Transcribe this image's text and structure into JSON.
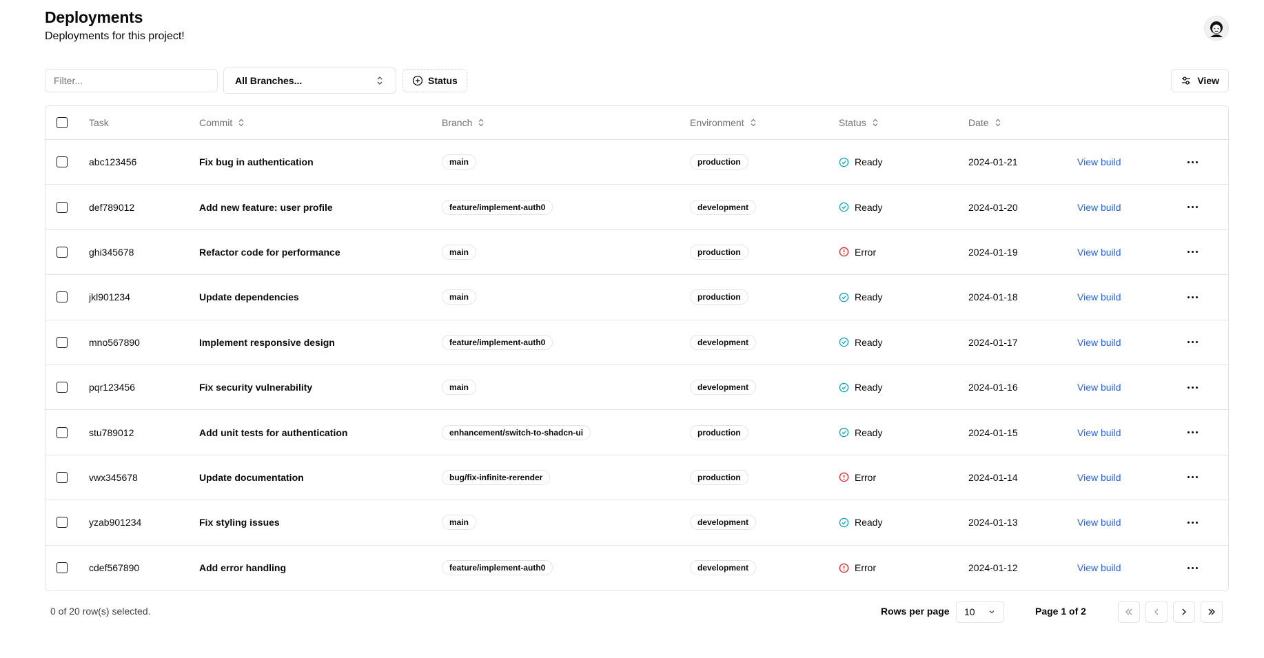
{
  "header": {
    "title": "Deployments",
    "subtitle": "Deployments for this project!",
    "avatar_icon": "user-avatar"
  },
  "toolbar": {
    "filter_placeholder": "Filter...",
    "filter_value": "",
    "branch_select": "All Branches...",
    "status_button": "Status",
    "view_button": "View"
  },
  "table": {
    "columns": [
      "Task",
      "Commit",
      "Branch",
      "Environment",
      "Status",
      "Date"
    ],
    "link_label": "View build",
    "rows": [
      {
        "task": "abc123456",
        "commit": "Fix bug in authentication",
        "branch": "main",
        "environment": "production",
        "status": "Ready",
        "date": "2024-01-21"
      },
      {
        "task": "def789012",
        "commit": "Add new feature: user profile",
        "branch": "feature/implement-auth0",
        "environment": "development",
        "status": "Ready",
        "date": "2024-01-20"
      },
      {
        "task": "ghi345678",
        "commit": "Refactor code for performance",
        "branch": "main",
        "environment": "production",
        "status": "Error",
        "date": "2024-01-19"
      },
      {
        "task": "jkl901234",
        "commit": "Update dependencies",
        "branch": "main",
        "environment": "production",
        "status": "Ready",
        "date": "2024-01-18"
      },
      {
        "task": "mno567890",
        "commit": "Implement responsive design",
        "branch": "feature/implement-auth0",
        "environment": "development",
        "status": "Ready",
        "date": "2024-01-17"
      },
      {
        "task": "pqr123456",
        "commit": "Fix security vulnerability",
        "branch": "main",
        "environment": "development",
        "status": "Ready",
        "date": "2024-01-16"
      },
      {
        "task": "stu789012",
        "commit": "Add unit tests for authentication",
        "branch": "enhancement/switch-to-shadcn-ui",
        "environment": "production",
        "status": "Ready",
        "date": "2024-01-15"
      },
      {
        "task": "vwx345678",
        "commit": "Update documentation",
        "branch": "bug/fix-infinite-rerender",
        "environment": "production",
        "status": "Error",
        "date": "2024-01-14"
      },
      {
        "task": "yzab901234",
        "commit": "Fix styling issues",
        "branch": "main",
        "environment": "development",
        "status": "Ready",
        "date": "2024-01-13"
      },
      {
        "task": "cdef567890",
        "commit": "Add error handling",
        "branch": "feature/implement-auth0",
        "environment": "development",
        "status": "Error",
        "date": "2024-01-12"
      }
    ]
  },
  "footer": {
    "selected_text": "0 of 20 row(s) selected.",
    "rows_per_page_label": "Rows per page",
    "rows_per_page_value": "10",
    "page_label": "Page 1 of 2"
  },
  "colors": {
    "ready": "#0ea5b7",
    "error": "#dc2626",
    "link": "#2563eb",
    "border": "#e4e4e7"
  }
}
